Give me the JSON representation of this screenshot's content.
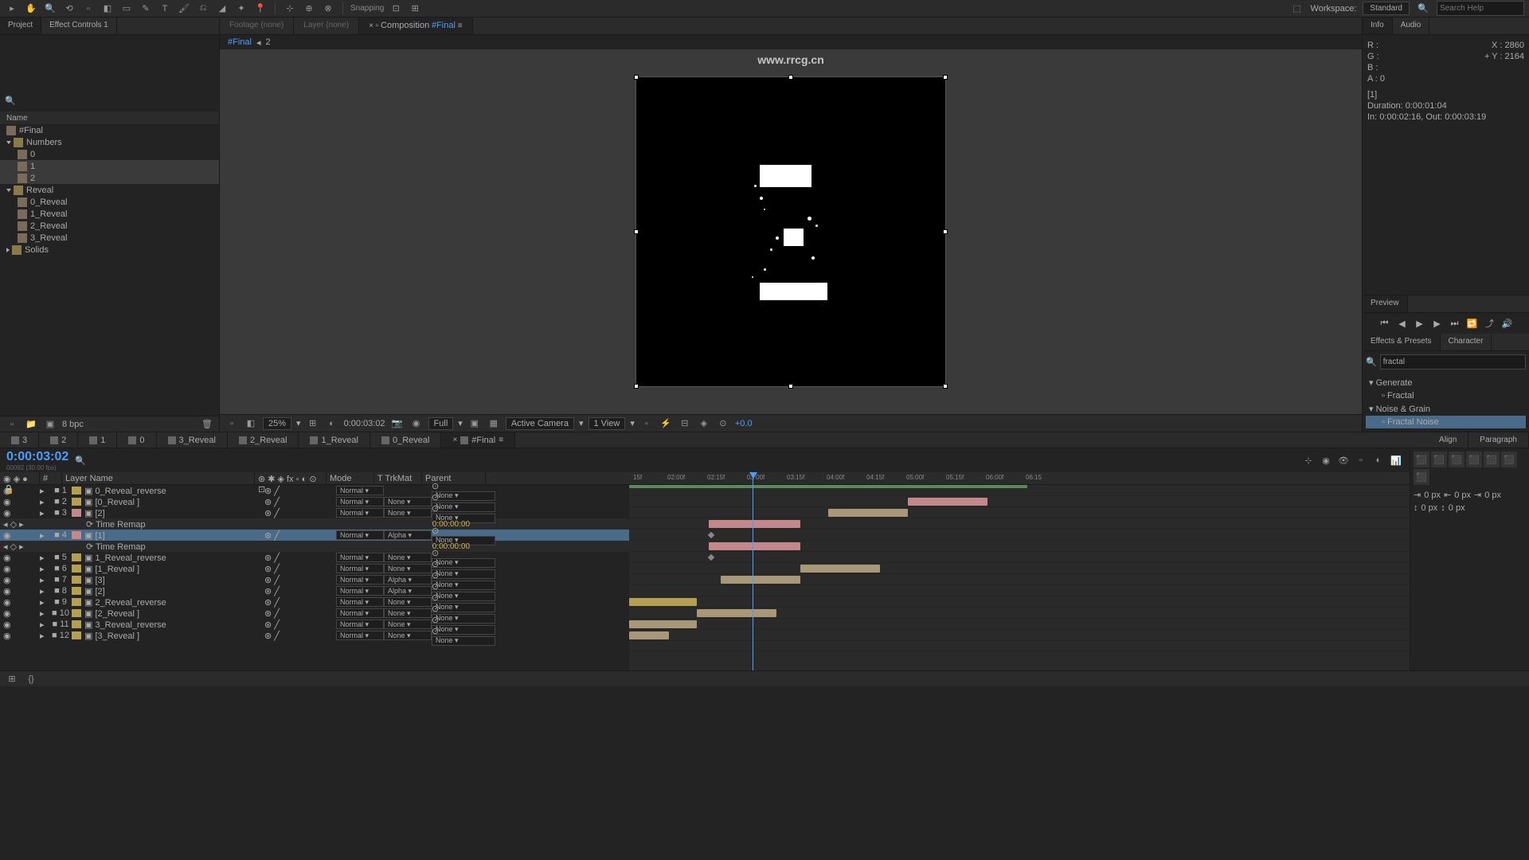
{
  "toolbar": {
    "snapping": "Snapping",
    "workspace_label": "Workspace:",
    "workspace_value": "Standard",
    "search_placeholder": "Search Help"
  },
  "watermark": "www.rrcg.cn",
  "left_panel": {
    "tabs": {
      "project": "Project",
      "effect_controls": "Effect Controls  1"
    },
    "name_header": "Name",
    "items": [
      {
        "name": "#Final",
        "type": "comp",
        "indent": 0
      },
      {
        "name": "Numbers",
        "type": "folder",
        "indent": 0,
        "open": true
      },
      {
        "name": "0",
        "type": "comp",
        "indent": 1
      },
      {
        "name": "1",
        "type": "comp",
        "indent": 1,
        "sel": true
      },
      {
        "name": "2",
        "type": "comp",
        "indent": 1,
        "sel": true
      },
      {
        "name": "Reveal",
        "type": "folder",
        "indent": 0,
        "open": true
      },
      {
        "name": "0_Reveal",
        "type": "comp",
        "indent": 1
      },
      {
        "name": "1_Reveal",
        "type": "comp",
        "indent": 1
      },
      {
        "name": "2_Reveal",
        "type": "comp",
        "indent": 1
      },
      {
        "name": "3_Reveal",
        "type": "comp",
        "indent": 1
      },
      {
        "name": "Solids",
        "type": "folder",
        "indent": 0
      }
    ],
    "bpc": "8 bpc"
  },
  "center": {
    "tabs": {
      "footage": "Footage (none)",
      "layer": "Layer (none)",
      "composition": "Composition",
      "comp_name": "#Final"
    },
    "crumb": {
      "name": "#Final",
      "num": "2"
    },
    "controls": {
      "zoom": "25%",
      "time": "0:00:03:02",
      "res": "Full",
      "camera": "Active Camera",
      "view": "1 View",
      "exposure": "+0.0"
    }
  },
  "right_panel": {
    "tabs": {
      "info": "Info",
      "audio": "Audio",
      "preview": "Preview",
      "effects": "Effects & Presets",
      "character": "Character"
    },
    "info": {
      "r": "R :",
      "g": "G :",
      "b": "B :",
      "a": "A : 0",
      "x": "X : 2860",
      "y": "Y : 2164",
      "selection": "[1]",
      "duration": "Duration: 0:00:01:04",
      "inout": "In: 0:00:02:16, Out: 0:00:03:19"
    },
    "search_value": "fractal",
    "effects_tree": {
      "cat1": "Generate",
      "item1": "Fractal",
      "cat2": "Noise & Grain",
      "item2": "Fractal Noise"
    }
  },
  "timeline": {
    "tabs": [
      "3",
      "2",
      "1",
      "0",
      "3_Reveal",
      "2_Reveal",
      "1_Reveal",
      "0_Reveal",
      "#Final"
    ],
    "active_tab": 8,
    "timecode": "0:00:03:02",
    "timecode_sub": "00092 (30.00 fps)",
    "cols": {
      "layer_name": "Layer Name",
      "mode": "Mode",
      "trkmat": "T  TrkMat",
      "parent": "Parent"
    },
    "time_ticks": [
      "15f",
      "02:00f",
      "02:15f",
      "03:00f",
      "03:15f",
      "04:00f",
      "04:15f",
      "05:00f",
      "05:15f",
      "06:00f",
      "06:15"
    ],
    "layers": [
      {
        "num": "1",
        "name": "0_Reveal_reverse",
        "mode": "Normal",
        "trk": "",
        "parent": "None",
        "color": "#b4a050"
      },
      {
        "num": "2",
        "name": "[0_Reveal ]",
        "mode": "Normal",
        "trk": "None",
        "parent": "None",
        "color": "#b4a050"
      },
      {
        "num": "3",
        "name": "[2]",
        "mode": "Normal",
        "trk": "None",
        "parent": "None",
        "color": "#c4888a"
      },
      {
        "num": "",
        "name": "Time Remap",
        "sub": true,
        "time": "0:00:00:00"
      },
      {
        "num": "4",
        "name": "[1]",
        "mode": "Normal",
        "trk": "Alpha",
        "parent": "None",
        "color": "#c4888a",
        "sel": true
      },
      {
        "num": "",
        "name": "Time Remap",
        "sub": true,
        "time": "0:00:00:00"
      },
      {
        "num": "5",
        "name": "1_Reveal_reverse",
        "mode": "Normal",
        "trk": "None",
        "parent": "None",
        "color": "#b4a050"
      },
      {
        "num": "6",
        "name": "[1_Reveal ]",
        "mode": "Normal",
        "trk": "None",
        "parent": "None",
        "color": "#b4a050"
      },
      {
        "num": "7",
        "name": "[3]",
        "mode": "Normal",
        "trk": "Alpha",
        "parent": "None",
        "color": "#b4a050"
      },
      {
        "num": "8",
        "name": "[2]",
        "mode": "Normal",
        "trk": "Alpha",
        "parent": "None",
        "color": "#b4a050"
      },
      {
        "num": "9",
        "name": "2_Reveal_reverse",
        "mode": "Normal",
        "trk": "None",
        "parent": "None",
        "color": "#b4a050"
      },
      {
        "num": "10",
        "name": "[2_Reveal ]",
        "mode": "Normal",
        "trk": "None",
        "parent": "None",
        "color": "#b4a050"
      },
      {
        "num": "11",
        "name": "3_Reveal_reverse",
        "mode": "Normal",
        "trk": "None",
        "parent": "None",
        "color": "#b4a050"
      },
      {
        "num": "12",
        "name": "[3_Reveal ]",
        "mode": "Normal",
        "trk": "None",
        "parent": "None",
        "color": "#b4a050"
      }
    ]
  },
  "align_panel": {
    "tabs": {
      "align": "Align",
      "paragraph": "Paragraph"
    },
    "px": "0 px"
  }
}
